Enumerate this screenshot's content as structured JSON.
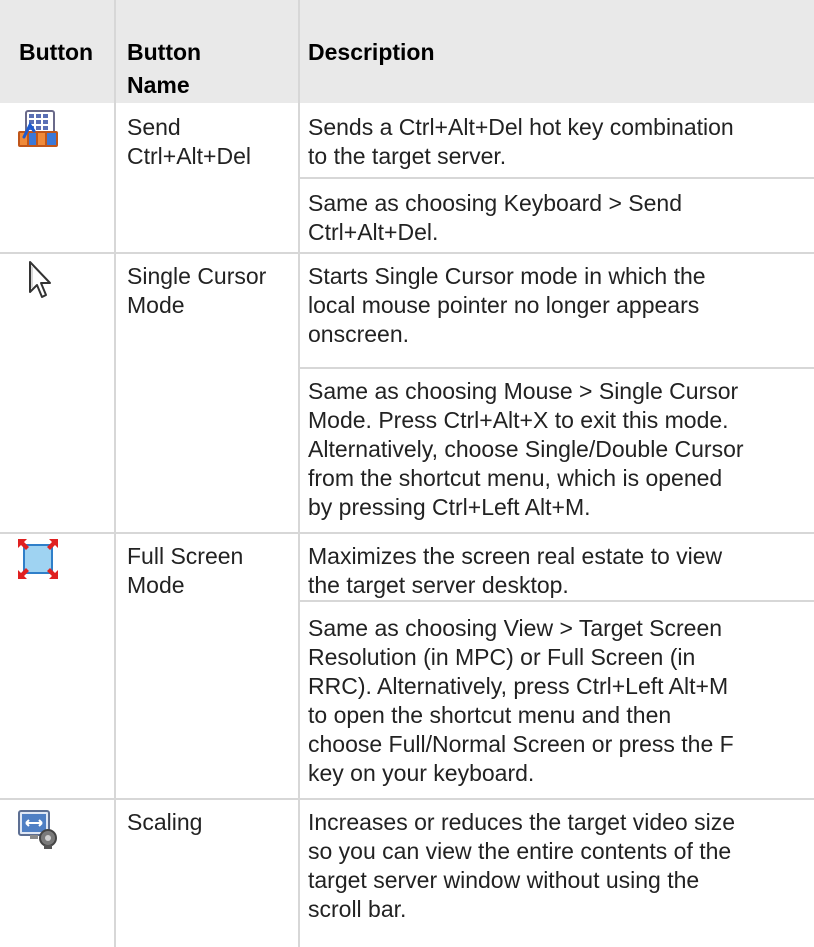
{
  "table": {
    "headers": {
      "button": "Button",
      "button_name_line1": "Button",
      "button_name_line2": "Name",
      "description": "Description"
    },
    "rows": [
      {
        "icon": "ctrl-alt-del-icon",
        "name_lines": [
          "Send",
          "Ctrl+Alt+Del"
        ],
        "paragraphs": [
          [
            "Sends a Ctrl+Alt+Del hot key combination",
            "to the target server."
          ],
          [
            "Same as choosing Keyboard > Send",
            "Ctrl+Alt+Del."
          ]
        ]
      },
      {
        "icon": "cursor-arrow-icon",
        "name_lines": [
          "Single Cursor",
          "Mode"
        ],
        "paragraphs": [
          [
            "Starts Single Cursor mode in which the",
            "local mouse pointer no longer appears",
            "onscreen."
          ],
          [
            "Same as choosing Mouse > Single Cursor",
            "Mode. Press Ctrl+Alt+X to exit this mode.",
            "Alternatively, choose Single/Double Cursor",
            "from the shortcut menu, which is opened",
            "by pressing Ctrl+Left Alt+M."
          ]
        ]
      },
      {
        "icon": "full-screen-icon",
        "name_lines": [
          "Full Screen",
          "Mode"
        ],
        "paragraphs": [
          [
            "Maximizes the screen real estate to view",
            "the target server desktop."
          ],
          [
            "Same as choosing View > Target Screen",
            "Resolution (in MPC) or Full Screen (in",
            "RRC). Alternatively, press Ctrl+Left Alt+M",
            "to open the shortcut menu and then",
            "choose Full/Normal Screen or press the F",
            "key on your keyboard."
          ]
        ]
      },
      {
        "icon": "scaling-icon",
        "name_lines": [
          "Scaling"
        ],
        "paragraphs": [
          [
            "Increases or reduces the target video size",
            "so you can view the entire contents of the",
            "target server window without using the",
            "scroll bar."
          ]
        ]
      }
    ]
  }
}
